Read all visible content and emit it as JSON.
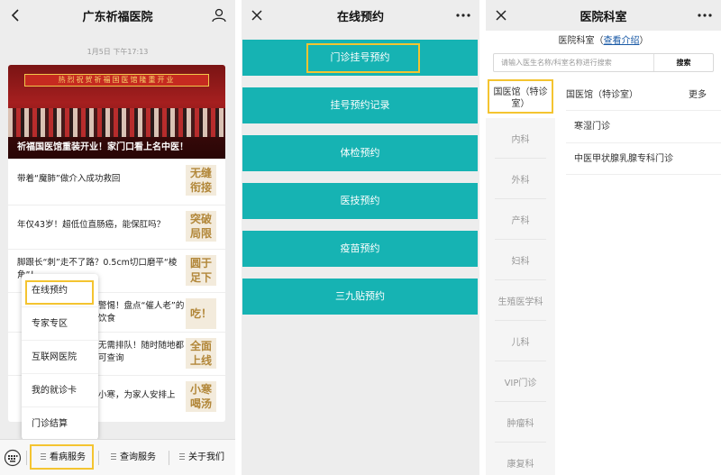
{
  "panel1": {
    "title": "广东祈福医院",
    "timestamp": "1月5日 下午17:13",
    "banner": {
      "sign": "热烈祝贺祈福国医馆隆重开业",
      "caption": "祈福国医馆重装开业！家门口看上名中医！"
    },
    "articles": [
      {
        "text": "带着“魔肺”做介入成功救回",
        "thumb": "无缝衔接"
      },
      {
        "text": "年仅43岁！超低位直肠癌，能保肛吗？",
        "thumb": "突破局限"
      },
      {
        "text": "脚跟长“刺”走不了路？0.5cm切口磨平“棱角”！",
        "thumb": "圆于足下"
      },
      {
        "text": "警惕！盘点“催人老”的饮食",
        "thumb": "吃！"
      },
      {
        "text": "无需排队！随时随地都可查询",
        "thumb": "全面上线"
      },
      {
        "text": "小寒，为家人安排上",
        "thumb": "小寒喝汤"
      }
    ],
    "popup": [
      "在线预约",
      "专家专区",
      "互联网医院",
      "我的就诊卡",
      "门诊结算"
    ],
    "menus": [
      "看病服务",
      "查询服务",
      "关于我们"
    ]
  },
  "panel2": {
    "title": "在线预约",
    "buttons": [
      "门诊挂号预约",
      "挂号预约记录",
      "体检预约",
      "医技预约",
      "疫苗预约",
      "三九贴预约"
    ]
  },
  "panel3": {
    "title": "医院科室",
    "header_prefix": "医院科室（",
    "header_link": "查看介绍",
    "header_suffix": "）",
    "search_placeholder": "请输入医生名称/科室名称进行搜索",
    "search_button": "搜索",
    "categories": [
      "国医馆（特诊室）",
      "内科",
      "外科",
      "产科",
      "妇科",
      "生殖医学科",
      "儿科",
      "VIP门诊",
      "肿瘤科",
      "康复科"
    ],
    "group_name": "国医馆（特诊室）",
    "more": "更多",
    "subdepartments": [
      "寒湿门诊",
      "中医甲状腺乳腺专科门诊"
    ]
  },
  "colors": {
    "accent_teal": "#16b3b3",
    "highlight": "#f4c430",
    "link": "#1a5aa6"
  },
  "icons": {
    "back": "chevron-left-icon",
    "profile": "person-icon",
    "close": "close-icon",
    "more": "more-dots-icon",
    "keyboard": "keyboard-icon",
    "menu": "menu-lines-icon"
  }
}
